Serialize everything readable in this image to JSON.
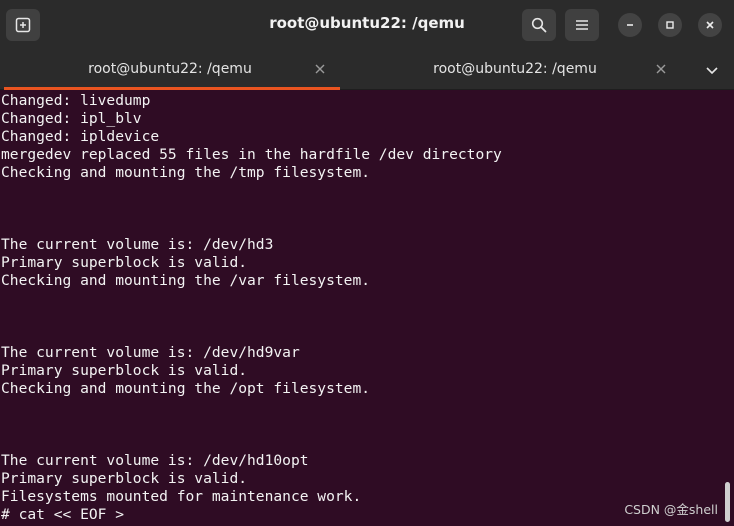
{
  "window": {
    "title": "root@ubuntu22: /qemu"
  },
  "tabs": [
    {
      "label": "root@ubuntu22: /qemu",
      "active": true
    },
    {
      "label": "root@ubuntu22: /qemu",
      "active": false
    }
  ],
  "terminal": {
    "lines": [
      "Changed: livedump",
      "Changed: ipl_blv",
      "Changed: ipldevice",
      "mergedev replaced 55 files in the hardfile /dev directory",
      "Checking and mounting the /tmp filesystem.",
      "",
      "",
      "",
      "The current volume is: /dev/hd3",
      "Primary superblock is valid.",
      "Checking and mounting the /var filesystem.",
      "",
      "",
      "",
      "The current volume is: /dev/hd9var",
      "Primary superblock is valid.",
      "Checking and mounting the /opt filesystem.",
      "",
      "",
      "",
      "The current volume is: /dev/hd10opt",
      "Primary superblock is valid.",
      "Filesystems mounted for maintenance work.",
      "# cat << EOF >"
    ]
  },
  "watermark": "CSDN @金shell",
  "colors": {
    "terminal_bg": "#2f0c24",
    "headerbar_bg": "#2b2b2b",
    "accent": "#e95420"
  },
  "icons": {
    "new_tab": "new-tab-icon",
    "search": "search-icon",
    "menu": "hamburger-menu-icon",
    "minimize": "minimize-icon",
    "maximize": "maximize-icon",
    "close": "close-icon",
    "tab_close": "tab-close-icon",
    "tab_list": "chevron-down-icon"
  }
}
